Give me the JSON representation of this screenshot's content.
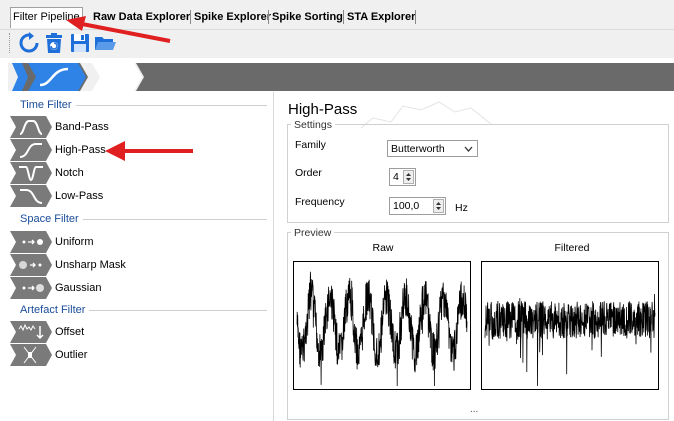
{
  "tabs": [
    {
      "label": "Filter Pipeline",
      "active": true
    },
    {
      "label": "Raw Data Explorer",
      "active": false
    },
    {
      "label": "Spike Explorer",
      "active": false
    },
    {
      "label": "Spike Sorting",
      "active": false
    },
    {
      "label": "STA Explorer",
      "active": false
    }
  ],
  "toolbar": {
    "icons": [
      "refresh-icon",
      "delete-icon",
      "save-icon",
      "open-folder-icon"
    ]
  },
  "pipeline": {
    "stages": [
      "high-pass-filter-stage"
    ]
  },
  "sidebar": {
    "groups": [
      {
        "title": "Time Filter",
        "items": [
          "Band-Pass",
          "High-Pass",
          "Notch",
          "Low-Pass"
        ]
      },
      {
        "title": "Space Filter",
        "items": [
          "Uniform",
          "Unsharp Mask",
          "Gaussian"
        ]
      },
      {
        "title": "Artefact Filter",
        "items": [
          "Offset",
          "Outlier"
        ]
      }
    ]
  },
  "panel": {
    "title": "High-Pass",
    "settings_legend": "Settings",
    "family_label": "Family",
    "family_value": "Butterworth",
    "order_label": "Order",
    "order_value": "4",
    "frequency_label": "Frequency",
    "frequency_value": "100,0",
    "frequency_unit": "Hz",
    "preview_legend": "Preview",
    "raw_label": "Raw",
    "filtered_label": "Filtered",
    "more_indicator": "..."
  },
  "colors": {
    "accent_blue": "#1e6fd9",
    "arrow_red": "#e02020",
    "group_title": "#1a4c9a"
  }
}
